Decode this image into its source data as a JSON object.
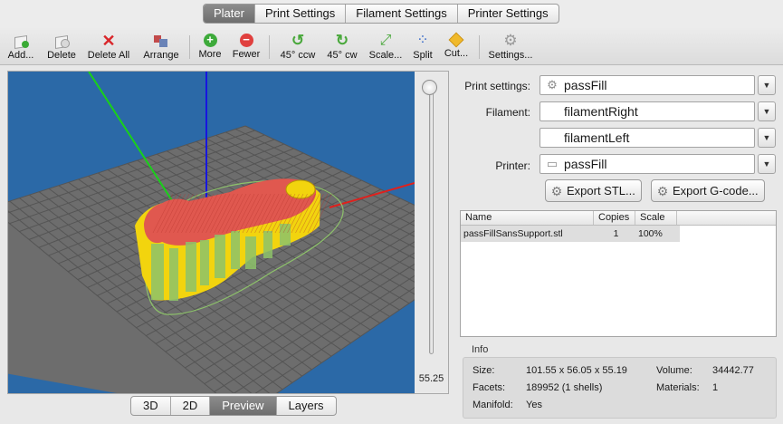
{
  "tabs": [
    "Plater",
    "Print Settings",
    "Filament Settings",
    "Printer Settings"
  ],
  "active_tab": "Plater",
  "toolbar": {
    "add": "Add...",
    "delete": "Delete",
    "delete_all": "Delete All",
    "arrange": "Arrange",
    "more": "More",
    "fewer": "Fewer",
    "rot_ccw": "45° ccw",
    "rot_cw": "45° cw",
    "scale": "Scale...",
    "split": "Split",
    "cut": "Cut...",
    "settings": "Settings..."
  },
  "zoom_value": "55.25",
  "view_modes": [
    "3D",
    "2D",
    "Preview",
    "Layers"
  ],
  "active_view": "Preview",
  "settings": {
    "print_label": "Print settings:",
    "print_value": "passFill",
    "filament_label": "Filament:",
    "filament_1": "filamentRight",
    "filament_2": "filamentLeft",
    "printer_label": "Printer:",
    "printer_value": "passFill"
  },
  "buttons": {
    "export_stl": "Export STL...",
    "export_gcode": "Export G-code..."
  },
  "table": {
    "headers": [
      "Name",
      "Copies",
      "Scale"
    ],
    "rows": [
      {
        "name": "passFillSansSupport.stl",
        "copies": "1",
        "scale": "100%"
      }
    ]
  },
  "info": {
    "title": "Info",
    "size_label": "Size:",
    "size_value": "101.55 x 56.05 x 55.19",
    "volume_label": "Volume:",
    "volume_value": "34442.77",
    "facets_label": "Facets:",
    "facets_value": "189952 (1 shells)",
    "materials_label": "Materials:",
    "materials_value": "1",
    "manifold_label": "Manifold:",
    "manifold_value": "Yes"
  },
  "colors": {
    "background": "#2b69a7",
    "bed": "#6d6d6d",
    "grid": "#555555",
    "perimeter_red": "#e0584f",
    "infill_yellow": "#f2d40e",
    "support_green": "#8dc26a",
    "axis_x": "#e0201c",
    "axis_y": "#19d119",
    "axis_z": "#1616e0"
  }
}
